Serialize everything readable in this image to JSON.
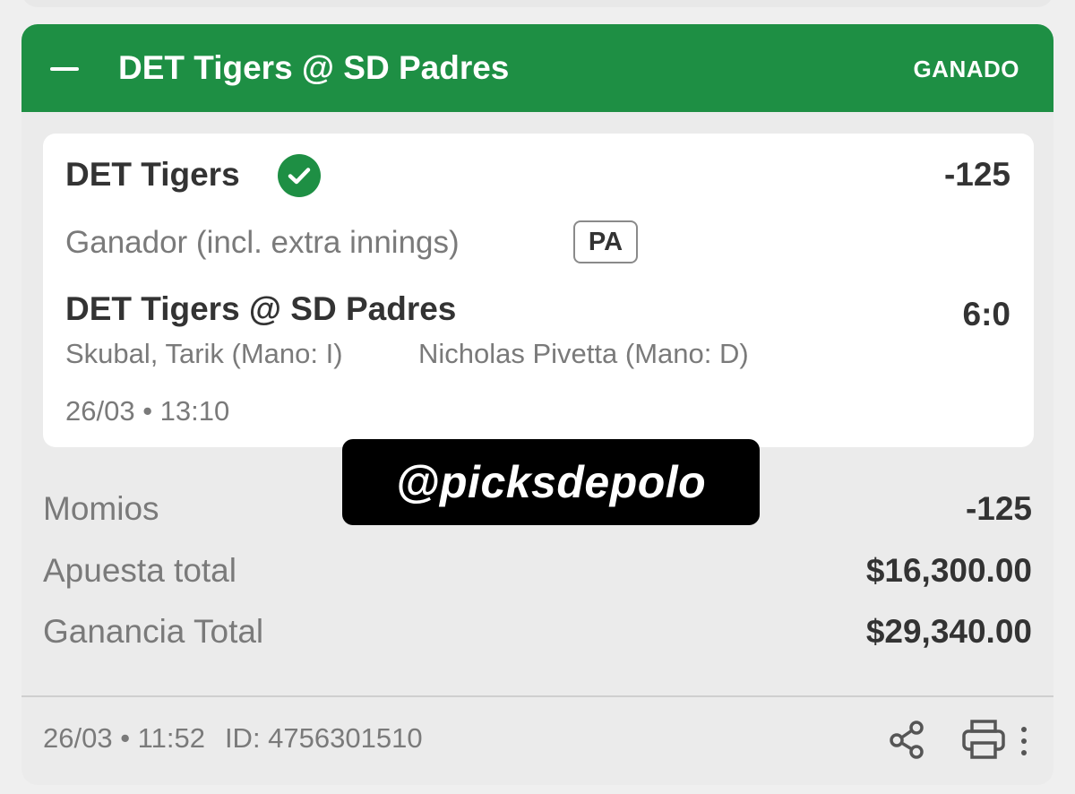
{
  "header": {
    "collapse_icon": "minus-icon",
    "title": "DET Tigers @ SD Padres",
    "status": "GANADO",
    "color": "#1e8f44"
  },
  "selection": {
    "team": "DET Tigers",
    "status_icon": "check-circle-icon",
    "odds": "-125",
    "market": "Ganador (incl. extra innings)",
    "badge": "PA",
    "event": "DET Tigers @ SD Padres",
    "score": "6:0",
    "pitcher_home": "Skubal, Tarik (Mano: I)",
    "pitcher_away": "Nicholas Pivetta (Mano: D)",
    "datetime": "26/03 • 13:10"
  },
  "summary": [
    {
      "label": "Momios",
      "value": "-125"
    },
    {
      "label": "Apuesta total",
      "value": "$16,300.00"
    },
    {
      "label": "Ganancia Total",
      "value": "$29,340.00"
    }
  ],
  "footer": {
    "datetime": "26/03 • 11:52",
    "id": "ID: 4756301510",
    "icons": [
      "share-icon",
      "print-icon",
      "more-vertical-icon"
    ]
  },
  "watermark": "@picksdepolo"
}
